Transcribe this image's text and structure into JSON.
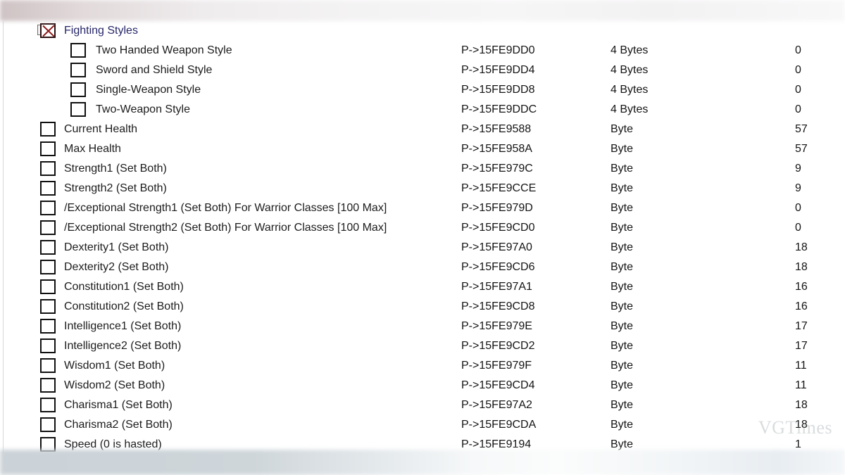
{
  "watermark": {
    "text": "VGTimes"
  },
  "tree": {
    "expander_glyph": "+",
    "rows": [
      {
        "label": "Fighting Styles",
        "level": 0,
        "kind": "group",
        "expander": true,
        "checkbox": "marked",
        "address": "",
        "type": "",
        "value": ""
      },
      {
        "label": "Two Handed Weapon Style",
        "level": 1,
        "kind": "item",
        "expander": false,
        "checkbox": "empty",
        "address": "P->15FE9DD0",
        "type": "4 Bytes",
        "value": "0"
      },
      {
        "label": "Sword and Shield Style",
        "level": 1,
        "kind": "item",
        "expander": false,
        "checkbox": "empty",
        "address": "P->15FE9DD4",
        "type": "4 Bytes",
        "value": "0"
      },
      {
        "label": "Single-Weapon Style",
        "level": 1,
        "kind": "item",
        "expander": false,
        "checkbox": "empty",
        "address": "P->15FE9DD8",
        "type": "4 Bytes",
        "value": "0"
      },
      {
        "label": "Two-Weapon Style",
        "level": 1,
        "kind": "item",
        "expander": false,
        "checkbox": "empty",
        "address": "P->15FE9DDC",
        "type": "4 Bytes",
        "value": "0"
      },
      {
        "label": "Current Health",
        "level": 0,
        "kind": "item",
        "expander": false,
        "checkbox": "empty",
        "address": "P->15FE9588",
        "type": "Byte",
        "value": "57"
      },
      {
        "label": "Max Health",
        "level": 0,
        "kind": "item",
        "expander": false,
        "checkbox": "empty",
        "address": "P->15FE958A",
        "type": "Byte",
        "value": "57"
      },
      {
        "label": "Strength1 (Set Both)",
        "level": 0,
        "kind": "item",
        "expander": false,
        "checkbox": "empty",
        "address": "P->15FE979C",
        "type": "Byte",
        "value": "9"
      },
      {
        "label": "Strength2 (Set Both)",
        "level": 0,
        "kind": "item",
        "expander": false,
        "checkbox": "empty",
        "address": "P->15FE9CCE",
        "type": "Byte",
        "value": "9"
      },
      {
        "label": "/Exceptional Strength1 (Set Both) For Warrior Classes [100 Max]",
        "level": 0,
        "kind": "item",
        "expander": false,
        "checkbox": "empty",
        "address": "P->15FE979D",
        "type": "Byte",
        "value": "0"
      },
      {
        "label": "/Exceptional Strength2 (Set Both) For Warrior Classes [100 Max]",
        "level": 0,
        "kind": "item",
        "expander": false,
        "checkbox": "empty",
        "address": "P->15FE9CD0",
        "type": "Byte",
        "value": "0"
      },
      {
        "label": "Dexterity1 (Set Both)",
        "level": 0,
        "kind": "item",
        "expander": false,
        "checkbox": "empty",
        "address": "P->15FE97A0",
        "type": "Byte",
        "value": "18"
      },
      {
        "label": "Dexterity2 (Set Both)",
        "level": 0,
        "kind": "item",
        "expander": false,
        "checkbox": "empty",
        "address": "P->15FE9CD6",
        "type": "Byte",
        "value": "18"
      },
      {
        "label": "Constitution1 (Set Both)",
        "level": 0,
        "kind": "item",
        "expander": false,
        "checkbox": "empty",
        "address": "P->15FE97A1",
        "type": "Byte",
        "value": "16"
      },
      {
        "label": "Constitution2 (Set Both)",
        "level": 0,
        "kind": "item",
        "expander": false,
        "checkbox": "empty",
        "address": "P->15FE9CD8",
        "type": "Byte",
        "value": "16"
      },
      {
        "label": "Intelligence1 (Set Both)",
        "level": 0,
        "kind": "item",
        "expander": false,
        "checkbox": "empty",
        "address": "P->15FE979E",
        "type": "Byte",
        "value": "17"
      },
      {
        "label": "Intelligence2 (Set Both)",
        "level": 0,
        "kind": "item",
        "expander": false,
        "checkbox": "empty",
        "address": "P->15FE9CD2",
        "type": "Byte",
        "value": "17"
      },
      {
        "label": "Wisdom1 (Set Both)",
        "level": 0,
        "kind": "item",
        "expander": false,
        "checkbox": "empty",
        "address": "P->15FE979F",
        "type": "Byte",
        "value": "11"
      },
      {
        "label": "Wisdom2 (Set Both)",
        "level": 0,
        "kind": "item",
        "expander": false,
        "checkbox": "empty",
        "address": "P->15FE9CD4",
        "type": "Byte",
        "value": "11"
      },
      {
        "label": "Charisma1 (Set Both)",
        "level": 0,
        "kind": "item",
        "expander": false,
        "checkbox": "empty",
        "address": "P->15FE97A2",
        "type": "Byte",
        "value": "18"
      },
      {
        "label": "Charisma2 (Set Both)",
        "level": 0,
        "kind": "item",
        "expander": false,
        "checkbox": "empty",
        "address": "P->15FE9CDA",
        "type": "Byte",
        "value": "18"
      },
      {
        "label": "Speed (0 is hasted)",
        "level": 0,
        "kind": "item",
        "expander": false,
        "checkbox": "empty",
        "address": "P->15FE9194",
        "type": "Byte",
        "value": "1"
      }
    ]
  }
}
